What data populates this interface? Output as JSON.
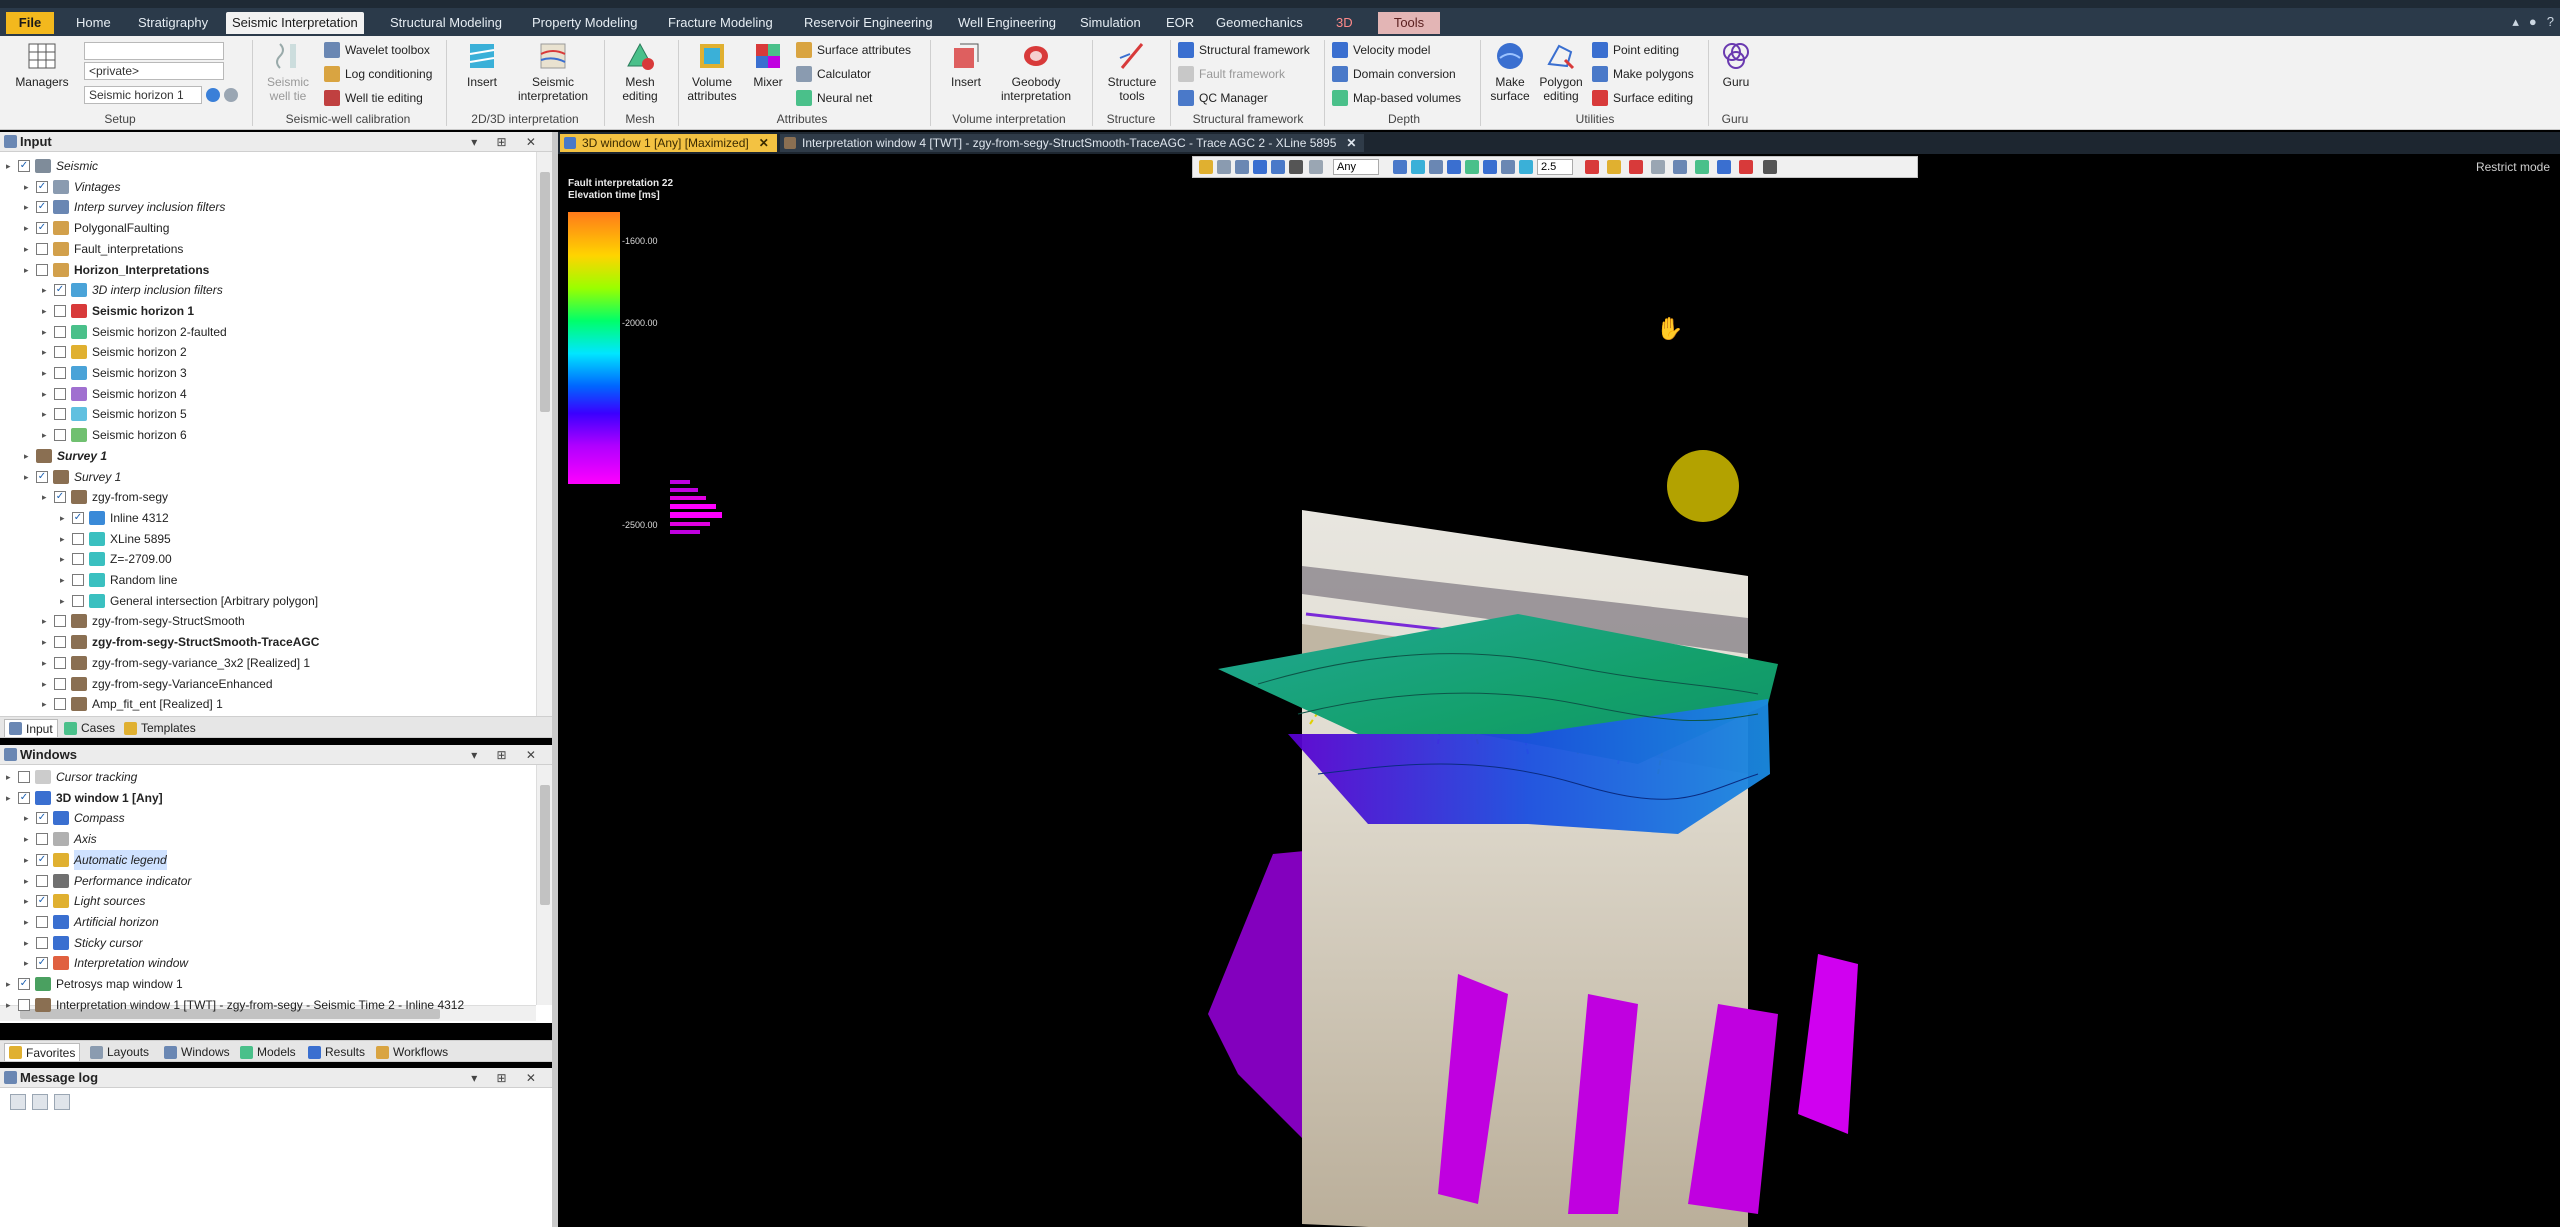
{
  "menubar": {
    "file": "File",
    "items": [
      "Home",
      "Stratigraphy",
      "Seismic Interpretation",
      "Structural Modeling",
      "Property Modeling",
      "Fracture Modeling",
      "Reservoir Engineering",
      "Well Engineering",
      "Simulation",
      "EOR",
      "Geomechanics",
      "3D",
      "Tools"
    ],
    "active_tab": "Seismic Interpretation",
    "right_icons": [
      "collapse-ribbon-icon",
      "user-icon",
      "help-icon"
    ]
  },
  "ribbon": {
    "setup": {
      "managers": "Managers",
      "private_combo": "<private>",
      "horizon_combo": "Seismic horizon 1",
      "group": "Setup"
    },
    "seismic_well_calibration": {
      "seismic_well_tie": "Seismic well tie",
      "wavelet_toolbox": "Wavelet toolbox",
      "log_conditioning": "Log conditioning",
      "well_tie_editing": "Well tie editing",
      "group": "Seismic-well calibration"
    },
    "interpretation_2d3d": {
      "insert": "Insert",
      "seismic_interpretation": "Seismic interpretation",
      "group": "2D/3D interpretation"
    },
    "mesh": {
      "mesh_editing": "Mesh editing",
      "group": "Mesh"
    },
    "attributes": {
      "volume_attributes": "Volume attributes",
      "mixer": "Mixer",
      "surface_attributes": "Surface attributes",
      "calculator": "Calculator",
      "neural_net": "Neural net",
      "group": "Attributes"
    },
    "volume_interpretation": {
      "insert": "Insert",
      "geobody_interpretation": "Geobody interpretation",
      "group": "Volume interpretation"
    },
    "structure": {
      "structure_tools": "Structure tools",
      "group": "Structure"
    },
    "structural_framework": {
      "structural_framework": "Structural framework",
      "fault_framework": "Fault framework",
      "qc_manager": "QC Manager",
      "group": "Structural framework"
    },
    "depth": {
      "velocity_model": "Velocity model",
      "domain_conversion": "Domain conversion",
      "map_based_volumes": "Map-based volumes",
      "group": "Depth"
    },
    "utilities": {
      "make_surface": "Make surface",
      "polygon_editing": "Polygon editing",
      "point_editing": "Point editing",
      "make_polygons": "Make polygons",
      "surface_editing": "Surface editing",
      "group": "Utilities"
    },
    "guru": {
      "guru": "Guru",
      "group": "Guru"
    }
  },
  "input_pane": {
    "title": "Input",
    "rows": [
      {
        "label": "Seismic",
        "indent": 0,
        "style": "italic",
        "checked": true,
        "icon": "#7f8c9a"
      },
      {
        "label": "Vintages",
        "indent": 1,
        "style": "italic",
        "checked": true,
        "icon": "#8a9bb0"
      },
      {
        "label": "Interp survey inclusion filters",
        "indent": 1,
        "style": "italic",
        "checked": true,
        "icon": "#6a87b3"
      },
      {
        "label": "PolygonalFaulting",
        "indent": 1,
        "style": "",
        "checked": true,
        "icon": "#d2a04b"
      },
      {
        "label": "Fault_interpretations",
        "indent": 1,
        "style": "",
        "checked": false,
        "icon": "#d2a04b"
      },
      {
        "label": "Horizon_Interpretations",
        "indent": 1,
        "style": "bold",
        "checked": false,
        "icon": "#d2a04b"
      },
      {
        "label": "3D interp inclusion filters",
        "indent": 2,
        "style": "italic",
        "checked": true,
        "icon": "#4aa3d8"
      },
      {
        "label": "Seismic horizon 1",
        "indent": 2,
        "style": "bold",
        "checked": false,
        "icon": "#d83a3a"
      },
      {
        "label": "Seismic horizon 2-faulted",
        "indent": 2,
        "style": "",
        "checked": false,
        "icon": "#4ac08a"
      },
      {
        "label": "Seismic horizon 2",
        "indent": 2,
        "style": "",
        "checked": false,
        "icon": "#e0b030"
      },
      {
        "label": "Seismic horizon 3",
        "indent": 2,
        "style": "",
        "checked": false,
        "icon": "#4aa3d8"
      },
      {
        "label": "Seismic horizon 4",
        "indent": 2,
        "style": "",
        "checked": false,
        "icon": "#a070d0"
      },
      {
        "label": "Seismic horizon 5",
        "indent": 2,
        "style": "",
        "checked": false,
        "icon": "#60c0e0"
      },
      {
        "label": "Seismic horizon 6",
        "indent": 2,
        "style": "",
        "checked": false,
        "icon": "#70c070"
      },
      {
        "label": "Survey 1",
        "indent": 1,
        "style": "italic-bold",
        "checked": null,
        "icon": "#8a6f52"
      },
      {
        "label": "Survey 1",
        "indent": 1,
        "style": "italic",
        "checked": true,
        "icon": "#8a6f52"
      },
      {
        "label": "zgy-from-segy",
        "indent": 2,
        "style": "",
        "checked": true,
        "icon": "#8a6f52"
      },
      {
        "label": "Inline 4312",
        "indent": 3,
        "style": "",
        "checked": true,
        "icon": "#3a8ad8"
      },
      {
        "label": "XLine 5895",
        "indent": 3,
        "style": "",
        "checked": false,
        "icon": "#3ac0c0"
      },
      {
        "label": "Z=-2709.00",
        "indent": 3,
        "style": "",
        "checked": false,
        "icon": "#3ac0c0"
      },
      {
        "label": "Random line",
        "indent": 3,
        "style": "",
        "checked": false,
        "icon": "#3ac0c0"
      },
      {
        "label": "General intersection [Arbitrary polygon]",
        "indent": 3,
        "style": "",
        "checked": false,
        "icon": "#3ac0c0"
      },
      {
        "label": "zgy-from-segy-StructSmooth",
        "indent": 2,
        "style": "",
        "checked": false,
        "icon": "#8a6f52"
      },
      {
        "label": "zgy-from-segy-StructSmooth-TraceAGC",
        "indent": 2,
        "style": "bold",
        "checked": false,
        "icon": "#8a6f52"
      },
      {
        "label": "zgy-from-segy-variance_3x2 [Realized] 1",
        "indent": 2,
        "style": "",
        "checked": false,
        "icon": "#8a6f52"
      },
      {
        "label": "zgy-from-segy-VarianceEnhanced",
        "indent": 2,
        "style": "",
        "checked": false,
        "icon": "#8a6f52"
      },
      {
        "label": "Amp_fit_ent [Realized] 1",
        "indent": 2,
        "style": "",
        "checked": false,
        "icon": "#8a6f52"
      }
    ]
  },
  "input_tabs": [
    "Input",
    "Cases",
    "Templates"
  ],
  "windows_pane": {
    "title": "Windows",
    "rows": [
      {
        "label": "Cursor tracking",
        "indent": 0,
        "style": "italic",
        "checked": false,
        "icon": "#cccccc"
      },
      {
        "label": "3D window 1 [Any]",
        "indent": 0,
        "style": "bold",
        "checked": true,
        "icon": "#3a6fd0"
      },
      {
        "label": "Compass",
        "indent": 1,
        "style": "italic",
        "checked": true,
        "icon": "#3a6fd0"
      },
      {
        "label": "Axis",
        "indent": 1,
        "style": "italic",
        "checked": false,
        "icon": "#b0b0b0"
      },
      {
        "label": "Automatic legend",
        "indent": 1,
        "style": "italic-sel",
        "checked": true,
        "icon": "#e0b030"
      },
      {
        "label": "Performance indicator",
        "indent": 1,
        "style": "italic",
        "checked": false,
        "icon": "#707070"
      },
      {
        "label": "Light sources",
        "indent": 1,
        "style": "italic",
        "checked": true,
        "icon": "#e0b030"
      },
      {
        "label": "Artificial horizon",
        "indent": 1,
        "style": "italic",
        "checked": false,
        "icon": "#3a6fd0"
      },
      {
        "label": "Sticky cursor",
        "indent": 1,
        "style": "italic",
        "checked": false,
        "icon": "#3a6fd0"
      },
      {
        "label": "Interpretation window",
        "indent": 1,
        "style": "italic",
        "checked": true,
        "icon": "#e06040"
      },
      {
        "label": "Petrosys map window 1",
        "indent": 0,
        "style": "",
        "checked": true,
        "icon": "#4aa060"
      },
      {
        "label": "Interpretation window 1 [TWT] - zgy-from-segy - Seismic Time 2 - Inline 4312",
        "indent": 0,
        "style": "",
        "checked": false,
        "icon": "#8a6f52"
      }
    ]
  },
  "windows_tabs": [
    "Favorites",
    "Layouts",
    "Windows",
    "Models",
    "Results",
    "Workflows"
  ],
  "message_log": {
    "title": "Message log"
  },
  "doc_tabs": [
    {
      "label": "3D window 1 [Any] [Maximized]",
      "active": true
    },
    {
      "label": "Interpretation window 4 [TWT] - zgy-from-segy-StructSmooth-TraceAGC - Trace AGC 2 - XLine 5895",
      "active": false
    }
  ],
  "viewport": {
    "restrict_mode": "Restrict mode",
    "toolbar": {
      "domain_combo": "Any",
      "zoom_value": "2.5"
    },
    "legend": {
      "title": "Fault interpretation 22",
      "subtitle": "Elevation time [ms]",
      "ticks": [
        "-1600.00",
        "-2000.00",
        "-2500.00"
      ]
    },
    "colors": {
      "horizon_green": "#1aa58a",
      "horizon_blue": "#1a6fe0",
      "fault_magenta": "#c000e0"
    }
  }
}
